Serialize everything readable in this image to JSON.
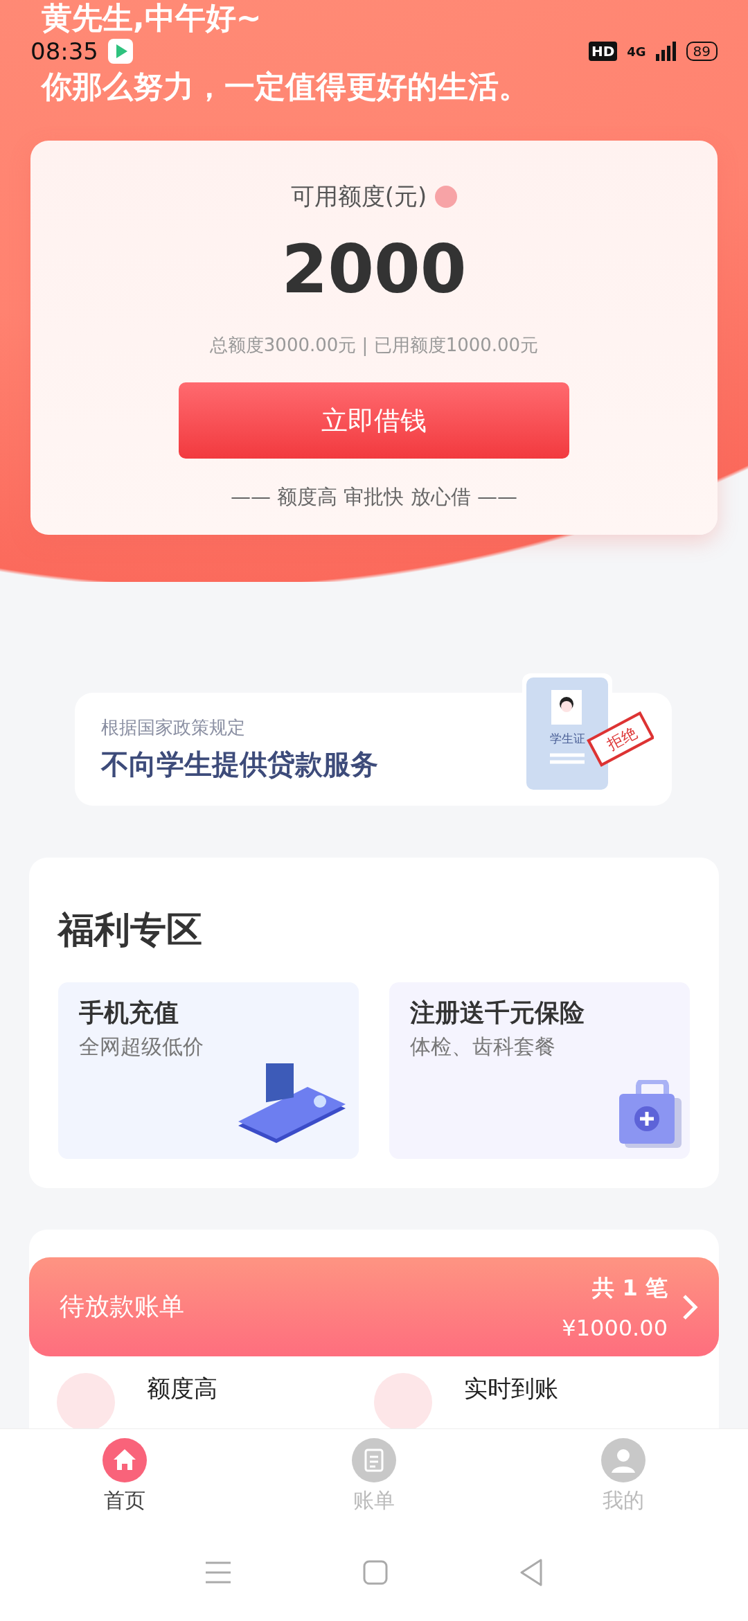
{
  "header": {
    "greeting": "黄先生,中午好~",
    "motto": "你那么努力，一定值得更好的生活。"
  },
  "status_bar": {
    "time": "08:35",
    "hd": "HD",
    "network": "4G",
    "battery": "89"
  },
  "credit_card": {
    "title": "可用额度(元)",
    "amount": "2000",
    "summary": "总额度3000.00元 | 已用额度1000.00元",
    "button": "立即借钱",
    "slogan": "—— 额度高 审批快 放心借 ——"
  },
  "notice": {
    "caption": "根据国家政策规定",
    "headline": "不向学生提供贷款服务",
    "id_label": "学生证",
    "stamp": "拒绝"
  },
  "welfare": {
    "title": "福利专区",
    "cards": [
      {
        "kind": "phone",
        "title": "手机充值",
        "subtitle": "全网超级低价"
      },
      {
        "kind": "medkit",
        "title": "注册送千元保险",
        "subtitle": "体检、齿科套餐"
      }
    ]
  },
  "pending_bill": {
    "label": "待放款账单",
    "count": "共 1 笔",
    "amount": "¥1000.00"
  },
  "features": [
    "额度高",
    "实时到账"
  ],
  "tab_bar": [
    {
      "kind": "home",
      "label": "首页",
      "selected": true
    },
    {
      "kind": "bill",
      "label": "账单",
      "selected": false
    },
    {
      "kind": "user",
      "label": "我的",
      "selected": false
    }
  ]
}
